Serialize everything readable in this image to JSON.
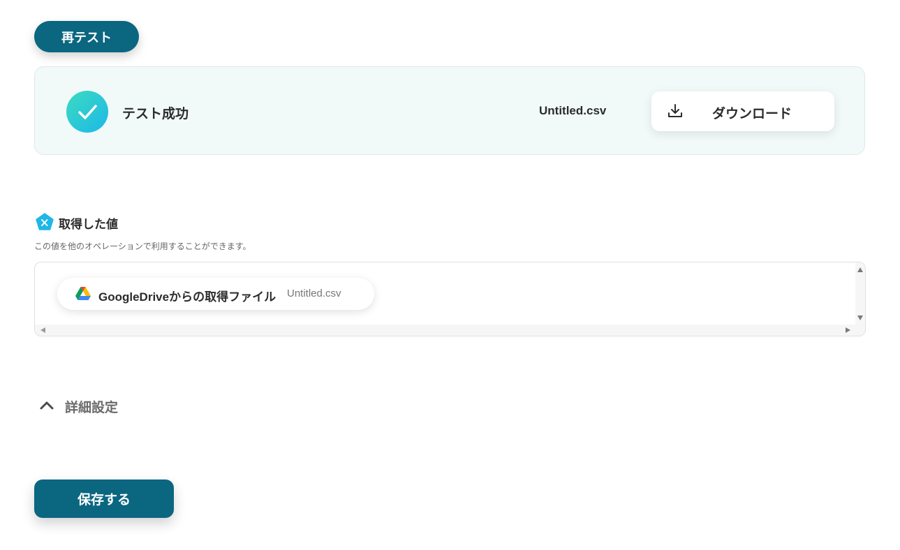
{
  "buttons": {
    "retest_label": "再テスト",
    "save_label": "保存する"
  },
  "result": {
    "status": "テスト成功",
    "filename": "Untitled.csv",
    "download_label": "ダウンロード",
    "status_icon": "check-icon",
    "download_icon": "download-icon"
  },
  "retrieved": {
    "title": "取得した値",
    "description": "この値を他のオペレーションで利用することができます。",
    "title_icon": "variable-icon",
    "items": [
      {
        "label": "GoogleDriveからの取得ファイル",
        "value": "Untitled.csv",
        "icon": "google-drive-icon"
      }
    ]
  },
  "advanced": {
    "label": "詳細設定",
    "expanded": true,
    "icon": "chevron-up-icon"
  },
  "colors": {
    "primary": "#0b6680",
    "success_gradient_start": "#3ddbc0",
    "success_gradient_end": "#1bb8e8",
    "card_bg": "#f2f9f9"
  }
}
